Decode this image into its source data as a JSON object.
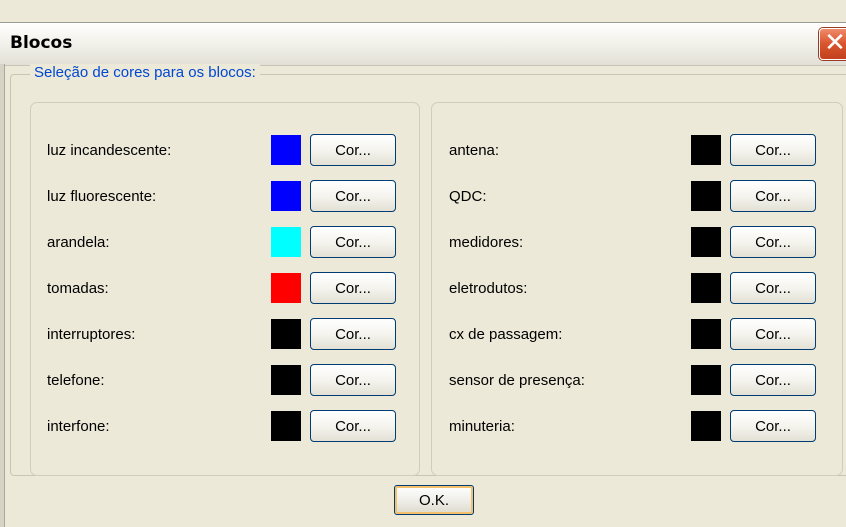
{
  "window": {
    "title": "Blocos",
    "close_glyph": "✕"
  },
  "group": {
    "legend": "Seleção de cores para os blocos:"
  },
  "left_panel": {
    "rows": [
      {
        "label": "luz incandescente:",
        "color": "#0000ff",
        "button": "Cor..."
      },
      {
        "label": "luz fluorescente:",
        "color": "#0000ff",
        "button": "Cor..."
      },
      {
        "label": "arandela:",
        "color": "#00ffff",
        "button": "Cor..."
      },
      {
        "label": "tomadas:",
        "color": "#ff0000",
        "button": "Cor..."
      },
      {
        "label": "interruptores:",
        "color": "#000000",
        "button": "Cor..."
      },
      {
        "label": "telefone:",
        "color": "#000000",
        "button": "Cor..."
      },
      {
        "label": "interfone:",
        "color": "#000000",
        "button": "Cor..."
      }
    ]
  },
  "right_panel": {
    "rows": [
      {
        "label": "antena:",
        "color": "#000000",
        "button": "Cor..."
      },
      {
        "label": "QDC:",
        "color": "#000000",
        "button": "Cor..."
      },
      {
        "label": "medidores:",
        "color": "#000000",
        "button": "Cor..."
      },
      {
        "label": "eletrodutos:",
        "color": "#000000",
        "button": "Cor..."
      },
      {
        "label": "cx de passagem:",
        "color": "#000000",
        "button": "Cor..."
      },
      {
        "label": "sensor de presença:",
        "color": "#000000",
        "button": "Cor..."
      },
      {
        "label": "minuteria:",
        "color": "#000000",
        "button": "Cor..."
      }
    ]
  },
  "footer": {
    "ok_label": "O.K."
  }
}
